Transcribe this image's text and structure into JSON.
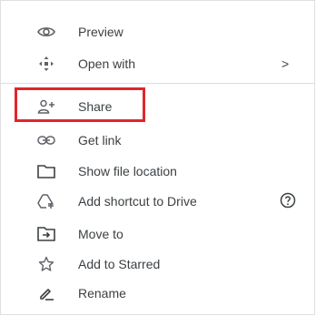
{
  "menu": {
    "items": [
      {
        "label": "Preview",
        "icon": "eye-icon"
      },
      {
        "label": "Open with",
        "icon": "move-arrows-icon",
        "submenu_indicator": ">"
      },
      {
        "label": "Share",
        "icon": "person-add-icon"
      },
      {
        "label": "Get link",
        "icon": "link-icon"
      },
      {
        "label": "Show file location",
        "icon": "folder-icon"
      },
      {
        "label": "Add shortcut to Drive",
        "icon": "add-shortcut-icon",
        "help_icon": "help-icon"
      },
      {
        "label": "Move to",
        "icon": "move-to-folder-icon"
      },
      {
        "label": "Add to Starred",
        "icon": "star-outline-icon"
      },
      {
        "label": "Rename",
        "icon": "pencil-icon"
      }
    ]
  },
  "colors": {
    "text": "#3c4043",
    "icon": "#5f6368",
    "highlight_border": "#e0262c",
    "divider": "#dadce0"
  }
}
